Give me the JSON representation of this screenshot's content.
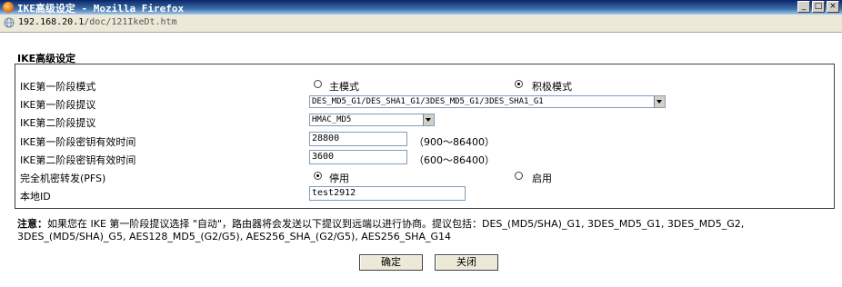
{
  "window": {
    "title": "IKE高级设定 - Mozilla Firefox",
    "buttons": {
      "minimize": "_",
      "maximize": "□",
      "close": "×"
    }
  },
  "address": {
    "host": "192.168.20.1",
    "path": "/doc/121IkeDt.htm"
  },
  "page": {
    "section_title": "IKE高级设定"
  },
  "form": {
    "mode": {
      "label": "IKE第一阶段模式",
      "options": [
        {
          "label": "主模式",
          "checked": false
        },
        {
          "label": "积极模式",
          "checked": true
        }
      ]
    },
    "phase1_proposal": {
      "label": "IKE第一阶段提议",
      "value": "DES_MD5_G1/DES_SHA1_G1/3DES_MD5_G1/3DES_SHA1_G1"
    },
    "phase2_proposal": {
      "label": "IKE第二阶段提议",
      "value": "HMAC_MD5"
    },
    "phase1_lifetime": {
      "label": "IKE第一阶段密钥有效时间",
      "value": "28800",
      "range": "（900～86400）"
    },
    "phase2_lifetime": {
      "label": "IKE第二阶段密钥有效时间",
      "value": "3600",
      "range": "（600～86400）"
    },
    "pfs": {
      "label": "完全机密转发(PFS)",
      "options": [
        {
          "label": "停用",
          "checked": true
        },
        {
          "label": "启用",
          "checked": false
        }
      ]
    },
    "local_id": {
      "label": "本地ID",
      "value": "test2912"
    }
  },
  "note": {
    "prefix": "注意：",
    "text": "如果您在 IKE 第一阶段提议选择 \"自动\"，路由器将会发送以下提议到远端以进行协商。提议包括：DES_(MD5/SHA)_G1, 3DES_MD5_G1, 3DES_MD5_G2, 3DES_(MD5/SHA)_G5, AES128_MD5_(G2/G5), AES256_SHA_(G2/G5), AES256_SHA_G14"
  },
  "buttons": {
    "ok": "确定",
    "close": "关闭"
  }
}
